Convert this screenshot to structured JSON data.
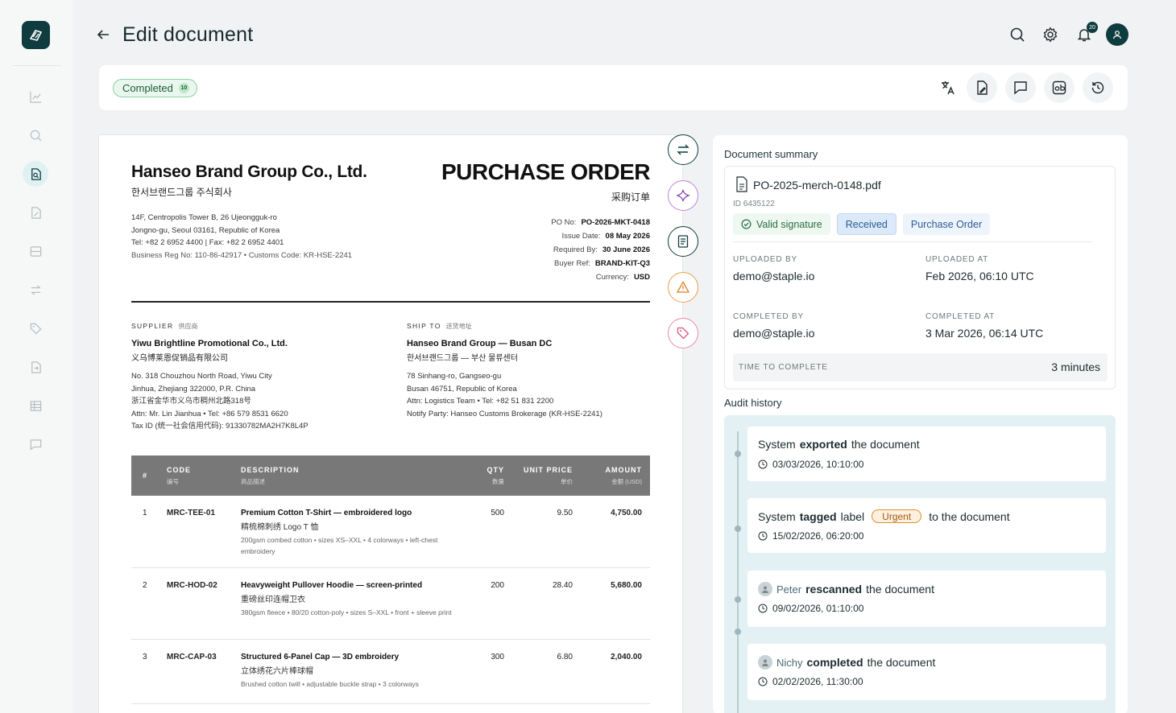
{
  "header": {
    "title": "Edit document",
    "notification_count": "20"
  },
  "status": {
    "label": "Completed",
    "count": "10"
  },
  "document": {
    "company": "Hanseo Brand Group Co., Ltd.",
    "company_kr": "한서브랜드그룹 주식회사",
    "address": [
      "14F, Centropolis Tower B, 26 Ujeongguk-ro",
      "Jongno-gu, Seoul 03161, Republic of Korea",
      "Tel: +82 2 6952 4400  |  Fax: +82 2 6952 4401",
      "Business Reg No: 110-86-42917  •  Customs Code: KR-HSE-2241"
    ],
    "title": "PURCHASE ORDER",
    "title_cn": "采购订单",
    "meta": [
      {
        "label": "PO No:",
        "value": "PO-2026-MKT-0418"
      },
      {
        "label": "Issue Date:",
        "value": "08 May 2026"
      },
      {
        "label": "Required By:",
        "value": "30 June 2026"
      },
      {
        "label": "Buyer Ref:",
        "value": "BRAND-KIT-Q3"
      },
      {
        "label": "Currency:",
        "value": "USD"
      }
    ],
    "supplier": {
      "label": "SUPPLIER",
      "label_cn": "供应商",
      "name": "Yiwu Brightline Promotional Co., Ltd.",
      "name_cn": "义乌博莱恩促销品有限公司",
      "lines": [
        "No. 318 Chouzhou North Road, Yiwu City",
        "Jinhua, Zhejiang 322000, P.R. China",
        "浙江省金华市义乌市稠州北路318号",
        "Attn: Mr. Lin Jianhua  •  Tel: +86 579 8531 6620",
        "Tax ID (统一社会信用代码): 91330782MA2H7K8L4P"
      ]
    },
    "ship_to": {
      "label": "SHIP TO",
      "label_cn": "送货地址",
      "name": "Hanseo Brand Group — Busan DC",
      "name_cn": "한서브랜드그룹 — 부산 물류센터",
      "lines": [
        "78 Sinhang-ro, Gangseo-gu",
        "Busan 46751, Republic of Korea",
        "Attn: Logistics Team  •  Tel: +82 51 831 2200",
        "Notify Party: Hanseo Customs Brokerage (KR-HSE-2241)"
      ]
    },
    "table": {
      "headers": [
        {
          "label": "#",
          "sub": ""
        },
        {
          "label": "CODE",
          "sub": "编号"
        },
        {
          "label": "DESCRIPTION",
          "sub": "商品描述"
        },
        {
          "label": "QTY",
          "sub": "数量"
        },
        {
          "label": "UNIT PRICE",
          "sub": "单价"
        },
        {
          "label": "AMOUNT",
          "sub": "金额 (USD)"
        }
      ],
      "rows": [
        {
          "num": "1",
          "code": "MRC-TEE-01",
          "title": "Premium Cotton T-Shirt — embroidered logo",
          "title_cn": "精梳棉刺绣 Logo T 恤",
          "spec": "200gsm combed cotton  •  sizes XS–XXL  •  4 colorways  •  left-chest embroidery",
          "qty": "500",
          "unit": "9.50",
          "amount": "4,750.00"
        },
        {
          "num": "2",
          "code": "MRC-HOD-02",
          "title": "Heavyweight Pullover Hoodie — screen-printed",
          "title_cn": "重磅丝印连帽卫衣",
          "spec": "380gsm fleece  •  80/20 cotton-poly  •  sizes S–XXL  •  front + sleeve print",
          "qty": "200",
          "unit": "28.40",
          "amount": "5,680.00"
        },
        {
          "num": "3",
          "code": "MRC-CAP-03",
          "title": "Structured 6-Panel Cap — 3D embroidery",
          "title_cn": "立体绣花六片棒球帽",
          "spec": "Brushed cotton twill  •  adjustable buckle strap  •  3 colorways",
          "qty": "300",
          "unit": "6.80",
          "amount": "2,040.00"
        }
      ]
    }
  },
  "summary": {
    "title": "Document summary",
    "file_name": "PO-2025-merch-0148.pdf",
    "file_id": "ID 6435122",
    "tags": [
      "Valid signature",
      "Received",
      "Purchase Order"
    ],
    "uploaded_by_label": "UPLOADED BY",
    "uploaded_by": "demo@staple.io",
    "uploaded_at_label": "UPLOADED AT",
    "uploaded_at": "Feb 2026, 06:10 UTC",
    "completed_by_label": "COMPLETED BY",
    "completed_by": "demo@staple.io",
    "completed_at_label": "COMPLETED AT",
    "completed_at": "3 Mar 2026, 06:14 UTC",
    "ttc_label": "TIME TO COMPLETE",
    "ttc": "3 minutes"
  },
  "audit": {
    "title": "Audit history",
    "events": [
      {
        "actor": "System",
        "verb": "exported",
        "rest": "the document",
        "time": "03/03/2026, 10:10:00"
      },
      {
        "actor": "System",
        "verb": "tagged",
        "mid": "label",
        "label": "Urgent",
        "rest": "to the document",
        "time": "15/02/2026, 06:20:00"
      },
      {
        "actor": "Peter",
        "verb": "rescanned",
        "rest": "the document",
        "time": "09/02/2026, 01:10:00"
      },
      {
        "actor": "Nichy",
        "verb": "completed",
        "rest": "the document",
        "time": "02/02/2026, 11:30:00"
      }
    ]
  },
  "colors": {
    "brand": "#0f3c3f",
    "accent_bg": "#e3f1f4",
    "success": "#2a6e40",
    "urgent": "#e0902e"
  }
}
